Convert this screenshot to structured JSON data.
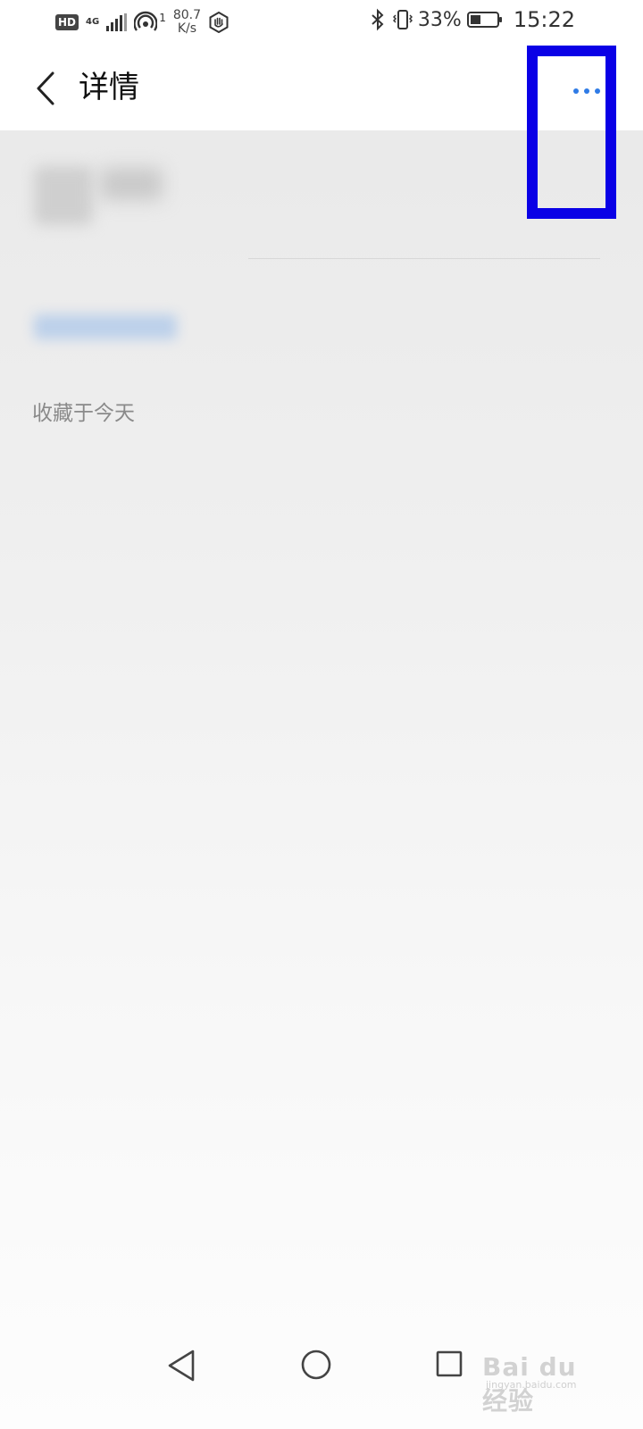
{
  "status_bar": {
    "hd": "HD",
    "network": "4G",
    "hotspot_count": "1",
    "speed_value": "80.7",
    "speed_unit": "K/s",
    "battery_percent": "33%",
    "time": "15:22"
  },
  "header": {
    "title": "详情",
    "accent_color": "#2f7be6"
  },
  "content": {
    "saved_text": "收藏于今天"
  },
  "watermark": {
    "text": "Bai du 经验",
    "sub": "jingyan.baidu.com"
  },
  "annotation": {
    "highlight_color": "#0a00e6"
  }
}
